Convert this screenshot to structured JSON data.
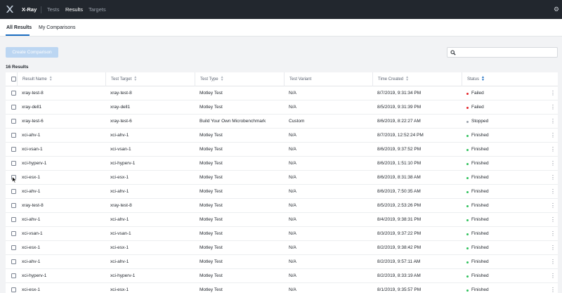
{
  "app": {
    "name": "X-Ray",
    "nav": [
      "Tests",
      "Results",
      "Targets"
    ],
    "active_nav": "Results"
  },
  "subnav": {
    "tabs": [
      "All Results",
      "My Comparisons"
    ],
    "active_tab": "All Results"
  },
  "toolbar": {
    "create_comparison_label": "Create Comparison",
    "search_placeholder": "",
    "search_value": ""
  },
  "results": {
    "count_label": "16 Results",
    "columns": [
      "Result Name",
      "Test Target",
      "Test Type",
      "Test Variant",
      "Time Created",
      "Status"
    ],
    "rows": [
      {
        "name": "xray-test-8",
        "target": "xray-test-8",
        "type": "Motley Test",
        "variant": "N/A",
        "time": "8/7/2019, 9:31:34 PM",
        "status": "Failed"
      },
      {
        "name": "xray-dell1",
        "target": "xray-dell1",
        "type": "Motley Test",
        "variant": "N/A",
        "time": "8/5/2019, 9:31:39 PM",
        "status": "Failed"
      },
      {
        "name": "xray-test-6",
        "target": "xray-test-6",
        "type": "Build Your Own Microbenchmark",
        "variant": "Custom",
        "time": "8/6/2019, 8:22:27 AM",
        "status": "Stopped"
      },
      {
        "name": "xci-ahv-1",
        "target": "xci-ahv-1",
        "type": "Motley Test",
        "variant": "N/A",
        "time": "8/7/2019, 12:52:24 PM",
        "status": "Finished"
      },
      {
        "name": "xci-vsan-1",
        "target": "xci-vsan-1",
        "type": "Motley Test",
        "variant": "N/A",
        "time": "8/6/2019, 9:37:52 PM",
        "status": "Finished"
      },
      {
        "name": "xci-hyperv-1",
        "target": "xci-hyperv-1",
        "type": "Motley Test",
        "variant": "N/A",
        "time": "8/6/2019, 1:51:10 PM",
        "status": "Finished"
      },
      {
        "name": "xci-esx-1",
        "target": "xci-esx-1",
        "type": "Motley Test",
        "variant": "N/A",
        "time": "8/6/2019, 8:31:38 AM",
        "status": "Finished"
      },
      {
        "name": "xci-ahv-1",
        "target": "xci-ahv-1",
        "type": "Motley Test",
        "variant": "N/A",
        "time": "8/6/2019, 7:50:35 AM",
        "status": "Finished"
      },
      {
        "name": "xray-test-8",
        "target": "xray-test-8",
        "type": "Motley Test",
        "variant": "N/A",
        "time": "8/5/2019, 2:53:26 PM",
        "status": "Finished"
      },
      {
        "name": "xci-ahv-1",
        "target": "xci-ahv-1",
        "type": "Motley Test",
        "variant": "N/A",
        "time": "8/4/2019, 9:38:31 PM",
        "status": "Finished"
      },
      {
        "name": "xci-vsan-1",
        "target": "xci-vsan-1",
        "type": "Motley Test",
        "variant": "N/A",
        "time": "8/3/2019, 9:37:22 PM",
        "status": "Finished"
      },
      {
        "name": "xci-esx-1",
        "target": "xci-esx-1",
        "type": "Motley Test",
        "variant": "N/A",
        "time": "8/2/2019, 9:38:42 PM",
        "status": "Finished"
      },
      {
        "name": "xci-ahv-1",
        "target": "xci-ahv-1",
        "type": "Motley Test",
        "variant": "N/A",
        "time": "8/2/2019, 9:57:11 AM",
        "status": "Finished"
      },
      {
        "name": "xci-hyperv-1",
        "target": "xci-hyperv-1",
        "type": "Motley Test",
        "variant": "N/A",
        "time": "8/2/2019, 8:33:19 AM",
        "status": "Finished"
      },
      {
        "name": "xci-esx-1",
        "target": "xci-esx-1",
        "type": "Motley Test",
        "variant": "N/A",
        "time": "8/1/2019, 9:35:57 PM",
        "status": "Finished"
      }
    ]
  },
  "colors": {
    "topbar": "#22272e",
    "accent": "#1b6dc1",
    "failed": "#e5252a",
    "stopped": "#9aa1ab",
    "finished": "#2fc25b"
  },
  "icons": {
    "logo": "xray-logo-icon",
    "settings": "gear-icon",
    "search": "search-icon",
    "row_menu": "more-vertical-icon",
    "sort": "sort-arrows-icon"
  }
}
